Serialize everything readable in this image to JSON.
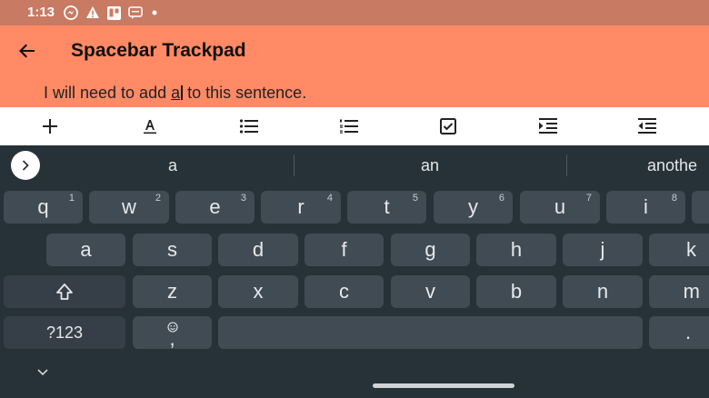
{
  "status_bar": {
    "time": "1:13",
    "icons": [
      "messenger-icon",
      "alert-icon",
      "trello-icon",
      "sms-icon",
      "dot-icon"
    ]
  },
  "app_bar": {
    "title": "Spacebar Trackpad"
  },
  "editor": {
    "text_before": "I will need to add ",
    "cursor_word": "a",
    "text_after": " to this sentence."
  },
  "toolbar": {
    "tools": [
      "add-icon",
      "text-format-icon",
      "bulleted-list-icon",
      "numbered-list-icon",
      "checkbox-icon",
      "indent-icon",
      "outdent-icon"
    ]
  },
  "keyboard": {
    "suggestions": [
      "a",
      "an",
      "anothe"
    ],
    "row1": [
      {
        "label": "q",
        "hint": "1"
      },
      {
        "label": "w",
        "hint": "2"
      },
      {
        "label": "e",
        "hint": "3"
      },
      {
        "label": "r",
        "hint": "4"
      },
      {
        "label": "t",
        "hint": "5"
      },
      {
        "label": "y",
        "hint": "6"
      },
      {
        "label": "u",
        "hint": "7"
      },
      {
        "label": "i",
        "hint": "8"
      }
    ],
    "row2": [
      "a",
      "s",
      "d",
      "f",
      "g",
      "h",
      "j",
      "k"
    ],
    "row3": [
      "z",
      "x",
      "c",
      "v",
      "b",
      "n",
      "m"
    ],
    "symbols_label": "?123",
    "comma_label": ",",
    "period_label": "."
  },
  "colors": {
    "app_bar": "#ff8a65",
    "status_bar": "#c97a63",
    "keyboard_bg": "#263238",
    "key": "#404b54"
  }
}
